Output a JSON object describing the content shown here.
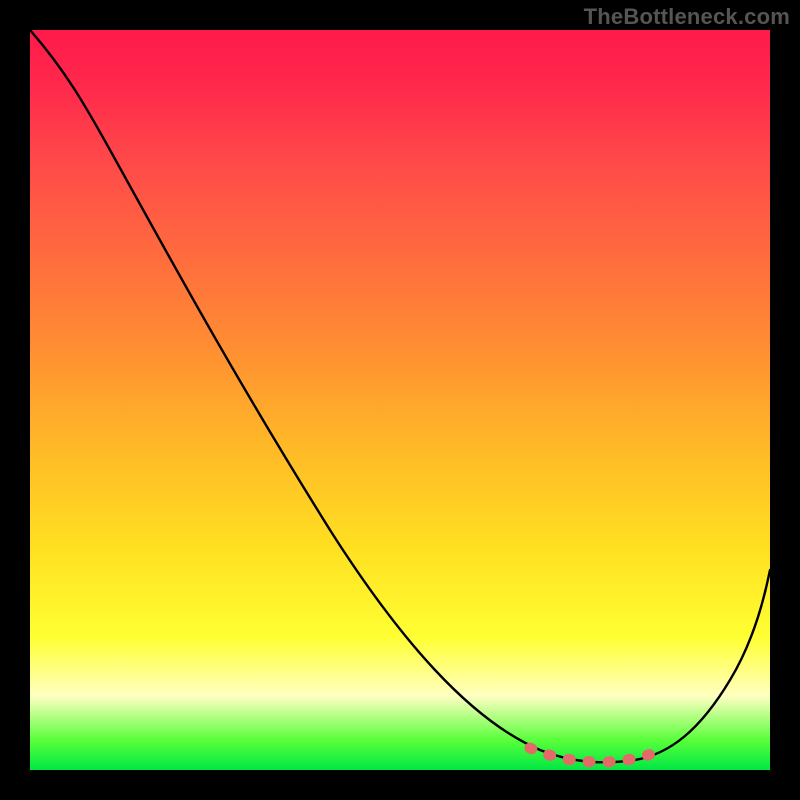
{
  "watermark": "TheBottleneck.com",
  "chart_data": {
    "type": "line",
    "title": "",
    "xlabel": "",
    "ylabel": "",
    "xlim": [
      0,
      100
    ],
    "ylim": [
      0,
      100
    ],
    "grid": false,
    "series": [
      {
        "name": "black-curve",
        "x": [
          0,
          7,
          14,
          21,
          28,
          35,
          42,
          49,
          56,
          63,
          70,
          74,
          78,
          82,
          86,
          90,
          94,
          100
        ],
        "y": [
          100,
          94,
          86,
          76.5,
          66.5,
          56,
          45.5,
          35,
          25,
          16,
          8.5,
          5,
          2.5,
          1.5,
          2,
          5,
          11,
          27
        ],
        "color": "#000000"
      },
      {
        "name": "red-dotted-floor",
        "x": [
          70,
          72.5,
          75,
          77.5,
          80,
          82.5,
          85
        ],
        "y": [
          2.5,
          2.0,
          1.7,
          1.5,
          1.6,
          1.8,
          2.2
        ],
        "color": "#e46a6a",
        "style": "dotted"
      }
    ],
    "colors": {
      "gradient_top": "#ff1a4b",
      "gradient_mid": "#ffe021",
      "gradient_bottom": "#00e844",
      "background": "#000000"
    }
  }
}
